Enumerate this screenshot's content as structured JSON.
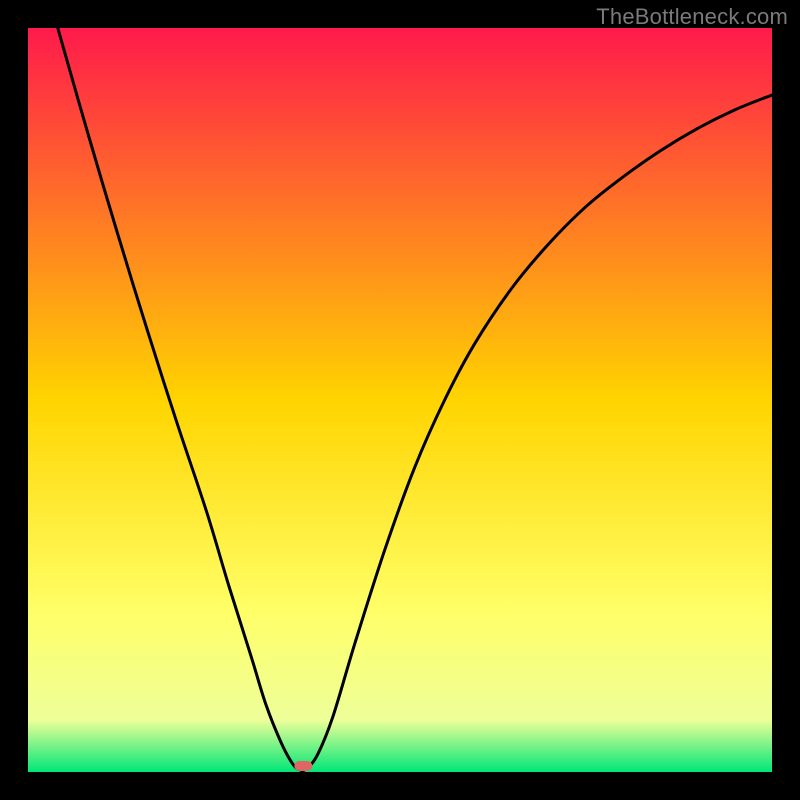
{
  "watermark": {
    "text": "TheBottleneck.com"
  },
  "chart_data": {
    "type": "line",
    "title": "",
    "xlabel": "",
    "ylabel": "",
    "xlim": [
      0,
      100
    ],
    "ylim": [
      0,
      100
    ],
    "grid": false,
    "legend": false,
    "background_gradient": {
      "stops": [
        {
          "pos": 0.0,
          "color": "#ff1a4b"
        },
        {
          "pos": 0.5,
          "color": "#ffd400"
        },
        {
          "pos": 0.78,
          "color": "#ffff66"
        },
        {
          "pos": 0.93,
          "color": "#eeff99"
        },
        {
          "pos": 1.0,
          "color": "#00e676"
        }
      ]
    },
    "curve": [
      {
        "x": 4.0,
        "y": 100.0
      },
      {
        "x": 8.0,
        "y": 86.0
      },
      {
        "x": 12.0,
        "y": 72.5
      },
      {
        "x": 16.0,
        "y": 59.5
      },
      {
        "x": 20.0,
        "y": 47.0
      },
      {
        "x": 24.0,
        "y": 35.0
      },
      {
        "x": 27.0,
        "y": 25.0
      },
      {
        "x": 30.0,
        "y": 15.5
      },
      {
        "x": 32.0,
        "y": 9.0
      },
      {
        "x": 34.0,
        "y": 4.0
      },
      {
        "x": 35.5,
        "y": 1.2
      },
      {
        "x": 36.5,
        "y": 0.3
      },
      {
        "x": 37.5,
        "y": 0.5
      },
      {
        "x": 39.0,
        "y": 2.5
      },
      {
        "x": 41.0,
        "y": 7.5
      },
      {
        "x": 44.0,
        "y": 17.5
      },
      {
        "x": 48.0,
        "y": 30.0
      },
      {
        "x": 52.0,
        "y": 41.0
      },
      {
        "x": 56.0,
        "y": 50.0
      },
      {
        "x": 60.0,
        "y": 57.5
      },
      {
        "x": 65.0,
        "y": 65.0
      },
      {
        "x": 70.0,
        "y": 71.0
      },
      {
        "x": 75.0,
        "y": 76.0
      },
      {
        "x": 80.0,
        "y": 80.0
      },
      {
        "x": 85.0,
        "y": 83.5
      },
      {
        "x": 90.0,
        "y": 86.5
      },
      {
        "x": 95.0,
        "y": 89.0
      },
      {
        "x": 100.0,
        "y": 91.0
      }
    ],
    "marker": {
      "x": 37.0,
      "y": 0.8,
      "color": "#e06666"
    }
  }
}
